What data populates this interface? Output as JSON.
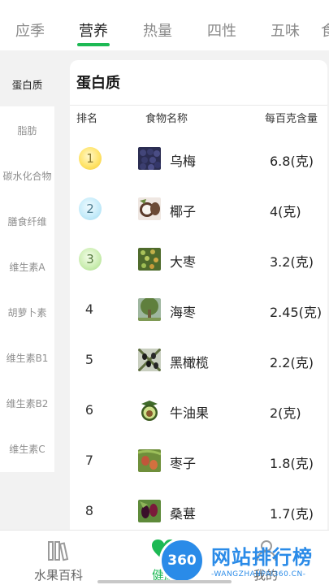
{
  "tabs": [
    {
      "label": "应季",
      "active": false
    },
    {
      "label": "营养",
      "active": true
    },
    {
      "label": "热量",
      "active": false
    },
    {
      "label": "四性",
      "active": false
    },
    {
      "label": "五味",
      "active": false
    },
    {
      "label": "食",
      "active": false
    }
  ],
  "sidebar": {
    "items": [
      {
        "label": "蛋白质",
        "active": true
      },
      {
        "label": "脂肪",
        "active": false
      },
      {
        "label": "碳水化合物",
        "active": false
      },
      {
        "label": "膳食纤维",
        "active": false
      },
      {
        "label": "维生素A",
        "active": false
      },
      {
        "label": "胡萝卜素",
        "active": false
      },
      {
        "label": "维生素B1",
        "active": false
      },
      {
        "label": "维生素B2",
        "active": false
      },
      {
        "label": "维生素C",
        "active": false
      }
    ]
  },
  "card": {
    "title": "蛋白质",
    "columns": {
      "rank": "排名",
      "name": "食物名称",
      "amount": "每百克含量"
    }
  },
  "rows": [
    {
      "rank": "1",
      "name": "乌梅",
      "amount": "6.8(克)",
      "medal": "gold",
      "thumb": "dark-plums"
    },
    {
      "rank": "2",
      "name": "椰子",
      "amount": "4(克)",
      "medal": "silver",
      "thumb": "coconut"
    },
    {
      "rank": "3",
      "name": "大枣",
      "amount": "3.2(克)",
      "medal": "bronze",
      "thumb": "jujube-tree"
    },
    {
      "rank": "4",
      "name": "海枣",
      "amount": "2.45(克)",
      "medal": "",
      "thumb": "date-palm"
    },
    {
      "rank": "5",
      "name": "黑橄榄",
      "amount": "2.2(克)",
      "medal": "",
      "thumb": "black-olives"
    },
    {
      "rank": "6",
      "name": "牛油果",
      "amount": "2(克)",
      "medal": "",
      "thumb": "avocado"
    },
    {
      "rank": "7",
      "name": "枣子",
      "amount": "1.8(克)",
      "medal": "",
      "thumb": "red-dates"
    },
    {
      "rank": "8",
      "name": "桑葚",
      "amount": "1.7(克)",
      "medal": "",
      "thumb": "mulberry"
    }
  ],
  "bottom_nav": {
    "items": [
      {
        "label": "水果百科",
        "icon": "books-icon",
        "active": false
      },
      {
        "label": "健康",
        "icon": "heart-icon",
        "active": true
      },
      {
        "label": "我的",
        "icon": "user-icon",
        "active": false
      }
    ]
  },
  "watermark": {
    "logo_text": "360",
    "title": "网站排行榜",
    "url": "-WANGZHANPAI360.CN-"
  },
  "colors": {
    "accent": "#1db954",
    "watermark": "#2a8be8",
    "background": "#f2f2f2"
  }
}
